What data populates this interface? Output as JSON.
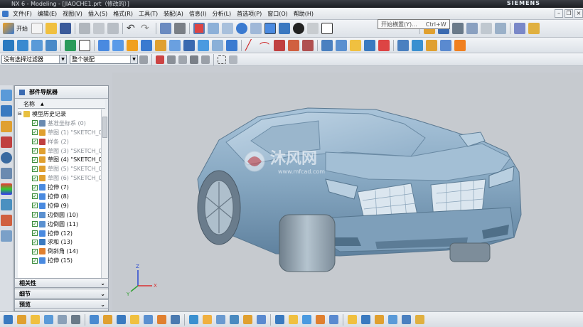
{
  "window": {
    "title": "NX 6 - Modeling - [JIAOCHE1.prt（修改的）]",
    "brand": "SIEMENS"
  },
  "menu": [
    "文件(F)",
    "编辑(E)",
    "视图(V)",
    "插入(S)",
    "格式(R)",
    "工具(T)",
    "装配(A)",
    "信息(I)",
    "分析(L)",
    "首选项(P)",
    "窗口(O)",
    "帮助(H)"
  ],
  "toolbar": {
    "start_label": "开始",
    "filter_value": "没有选择过滤器",
    "assembly_value": "整个装配"
  },
  "tooltip": {
    "label": "开始横置(Y)...",
    "shortcut": "Ctrl+W"
  },
  "navigator": {
    "title": "部件导航器",
    "column": "名称",
    "root": "模型历史记录",
    "items": [
      {
        "label": "基准坐标系 (0)",
        "dim": true,
        "icon": "datum-csys-icon"
      },
      {
        "label": "草图 (1) \"SKETCH_0",
        "dim": true,
        "icon": "sketch-icon"
      },
      {
        "label": "样条 (2)",
        "dim": true,
        "icon": "spline-icon"
      },
      {
        "label": "草图 (3) \"SKETCH_0",
        "dim": true,
        "icon": "sketch-icon"
      },
      {
        "label": "草图 (4) \"SKETCH_0",
        "dim": false,
        "icon": "sketch-icon"
      },
      {
        "label": "草图 (5) \"SKETCH_0",
        "dim": true,
        "icon": "sketch-icon"
      },
      {
        "label": "草图 (6) \"SKETCH_0",
        "dim": true,
        "icon": "sketch-icon"
      },
      {
        "label": "拉伸 (7)",
        "dim": false,
        "icon": "extrude-icon"
      },
      {
        "label": "拉伸 (8)",
        "dim": false,
        "icon": "extrude-icon"
      },
      {
        "label": "拉伸 (9)",
        "dim": false,
        "icon": "extrude-icon"
      },
      {
        "label": "边倒圆 (10)",
        "dim": false,
        "icon": "edge-blend-icon"
      },
      {
        "label": "边倒圆 (11)",
        "dim": false,
        "icon": "edge-blend-icon"
      },
      {
        "label": "拉伸 (12)",
        "dim": false,
        "icon": "extrude-icon"
      },
      {
        "label": "求和 (13)",
        "dim": false,
        "icon": "unite-icon"
      },
      {
        "label": "倒斜角 (14)",
        "dim": false,
        "icon": "chamfer-icon"
      },
      {
        "label": "拉伸 (15)",
        "dim": false,
        "icon": "extrude-icon"
      }
    ]
  },
  "panels": [
    "相关性",
    "细节",
    "预览"
  ],
  "watermark": {
    "main": "沐风网",
    "sub": "www.mfcad.com"
  }
}
